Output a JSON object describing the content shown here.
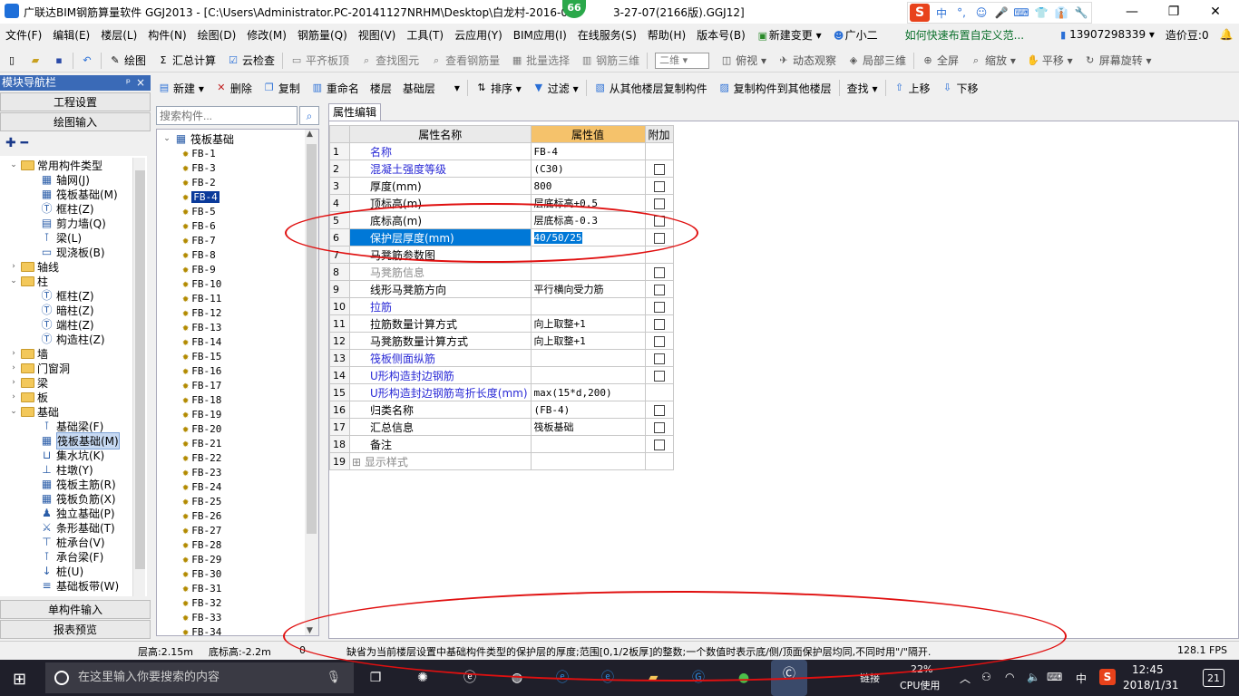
{
  "window": {
    "title": "广联达BIM钢筋算量软件 GGJ2013 - [C:\\Users\\Administrator.PC-20141127NRHM\\Desktop\\白龙村-2016-0",
    "title_tail": "3-27-07(2166版).GGJ12]",
    "badge": "66",
    "ime": {
      "logo": "S",
      "items": [
        "中",
        "°,",
        "☺",
        "🎤",
        "⌨",
        "👕",
        "👔",
        "🔧"
      ]
    },
    "controls": [
      "—",
      "❐",
      "✕"
    ]
  },
  "menubar": {
    "items": [
      "文件(F)",
      "编辑(E)",
      "楼层(L)",
      "构件(N)",
      "绘图(D)",
      "修改(M)",
      "钢筋量(Q)",
      "视图(V)",
      "工具(T)",
      "云应用(Y)",
      "BIM应用(I)",
      "在线服务(S)",
      "帮助(H)",
      "版本号(B)"
    ],
    "new_change": "新建变更 ▾",
    "assistant": "广小二",
    "hint": "如何快速布置自定义范...",
    "phone": "13907298339 ▾",
    "beans": "造价豆:0",
    "bell": "🔔"
  },
  "toolbar1": {
    "items": [
      {
        "icon": "draw-icon",
        "label": "绘图",
        "disabled": false
      },
      {
        "icon": "sum-icon",
        "label": "汇总计算",
        "disabled": false
      },
      {
        "icon": "cloud-check-icon",
        "label": "云检查",
        "disabled": false
      },
      {
        "icon": "flat-top-icon",
        "label": "平齐板顶",
        "disabled": true
      },
      {
        "icon": "find-icon",
        "label": "查找图元",
        "disabled": true
      },
      {
        "icon": "view-rebar-icon",
        "label": "查看钢筋量",
        "disabled": true
      },
      {
        "icon": "batch-select-icon",
        "label": "批量选择",
        "disabled": true
      },
      {
        "icon": "rebar-3d-icon",
        "label": "钢筋三维",
        "disabled": true
      }
    ],
    "view_select": "二维",
    "view_items": [
      {
        "icon": "top-view-icon",
        "label": "俯视 ▾"
      },
      {
        "icon": "dynamic-view-icon",
        "label": "动态观察"
      },
      {
        "icon": "local-3d-icon",
        "label": "局部三维"
      },
      {
        "icon": "fullscreen-icon",
        "label": "全屏"
      },
      {
        "icon": "zoom-icon",
        "label": "缩放 ▾"
      },
      {
        "icon": "pan-icon",
        "label": "平移 ▾"
      },
      {
        "icon": "rotate-icon",
        "label": "屏幕旋转 ▾"
      }
    ]
  },
  "nav": {
    "header": "模块导航栏",
    "pin": "ᵖ",
    "close": "×",
    "project_settings": "工程设置",
    "drawing_input": "绘图输入",
    "single_input": "单构件输入",
    "report_preview": "报表预览",
    "tools": "✚ ━",
    "tree": [
      {
        "depth": 0,
        "expander": "⌄",
        "icon": "folder",
        "label": "常用构件类型"
      },
      {
        "depth": 1,
        "icon": "grid",
        "label": "轴网(J)"
      },
      {
        "depth": 1,
        "icon": "raft",
        "label": "筏板基础(M)"
      },
      {
        "depth": 1,
        "icon": "column",
        "label": "框柱(Z)"
      },
      {
        "depth": 1,
        "icon": "wall",
        "label": "剪力墙(Q)"
      },
      {
        "depth": 1,
        "icon": "beam",
        "label": "梁(L)"
      },
      {
        "depth": 1,
        "icon": "slab",
        "label": "现浇板(B)"
      },
      {
        "depth": 0,
        "expander": "›",
        "icon": "folder",
        "label": "轴线"
      },
      {
        "depth": 0,
        "expander": "⌄",
        "icon": "folder",
        "label": "柱"
      },
      {
        "depth": 1,
        "icon": "column",
        "label": "框柱(Z)"
      },
      {
        "depth": 1,
        "icon": "column",
        "label": "暗柱(Z)"
      },
      {
        "depth": 1,
        "icon": "column",
        "label": "端柱(Z)"
      },
      {
        "depth": 1,
        "icon": "column",
        "label": "构造柱(Z)"
      },
      {
        "depth": 0,
        "expander": "›",
        "icon": "folder",
        "label": "墙"
      },
      {
        "depth": 0,
        "expander": "›",
        "icon": "folder",
        "label": "门窗洞"
      },
      {
        "depth": 0,
        "expander": "›",
        "icon": "folder",
        "label": "梁"
      },
      {
        "depth": 0,
        "expander": "›",
        "icon": "folder",
        "label": "板"
      },
      {
        "depth": 0,
        "expander": "⌄",
        "icon": "folder",
        "label": "基础"
      },
      {
        "depth": 1,
        "icon": "beam",
        "label": "基础梁(F)"
      },
      {
        "depth": 1,
        "icon": "raft",
        "label": "筏板基础(M)",
        "selected": true
      },
      {
        "depth": 1,
        "icon": "pit",
        "label": "集水坑(K)"
      },
      {
        "depth": 1,
        "icon": "pier",
        "label": "柱墩(Y)"
      },
      {
        "depth": 1,
        "icon": "raft",
        "label": "筏板主筋(R)"
      },
      {
        "depth": 1,
        "icon": "raft",
        "label": "筏板负筋(X)"
      },
      {
        "depth": 1,
        "icon": "footing",
        "label": "独立基础(P)"
      },
      {
        "depth": 1,
        "icon": "strip",
        "label": "条形基础(T)"
      },
      {
        "depth": 1,
        "icon": "cap",
        "label": "桩承台(V)"
      },
      {
        "depth": 1,
        "icon": "beam",
        "label": "承台梁(F)"
      },
      {
        "depth": 1,
        "icon": "pile",
        "label": "桩(U)"
      },
      {
        "depth": 1,
        "icon": "band",
        "label": "基础板带(W)"
      }
    ]
  },
  "mid_toolbar": {
    "items": [
      {
        "icon": "new-icon",
        "label": "新建 ▾"
      },
      {
        "icon": "delete-icon",
        "label": "删除"
      },
      {
        "icon": "copy-icon",
        "label": "复制"
      },
      {
        "icon": "rename-icon",
        "label": "重命名"
      }
    ],
    "floor_label": "楼层",
    "floor_value": "基础层",
    "sort": "排序 ▾",
    "filter": "过滤 ▾",
    "copy_from": "从其他楼层复制构件",
    "copy_to": "复制构件到其他楼层",
    "find": "查找 ▾",
    "move_up": "上移",
    "move_down": "下移"
  },
  "search": {
    "placeholder": "搜索构件..."
  },
  "component_list": {
    "root": "筏板基础",
    "items": [
      "FB-1",
      "FB-3",
      "FB-2",
      "FB-4",
      "FB-5",
      "FB-6",
      "FB-7",
      "FB-8",
      "FB-9",
      "FB-10",
      "FB-11",
      "FB-12",
      "FB-13",
      "FB-14",
      "FB-15",
      "FB-16",
      "FB-17",
      "FB-18",
      "FB-19",
      "FB-20",
      "FB-21",
      "FB-22",
      "FB-23",
      "FB-24",
      "FB-25",
      "FB-26",
      "FB-27",
      "FB-28",
      "FB-29",
      "FB-30",
      "FB-31",
      "FB-32",
      "FB-33",
      "FB-34"
    ],
    "selected": "FB-4"
  },
  "properties": {
    "tab": "属性编辑",
    "headers": {
      "name": "属性名称",
      "value": "属性值",
      "add": "附加"
    },
    "rows": [
      {
        "n": "1",
        "name": "名称",
        "value": "FB-4",
        "blue": true,
        "checkbox": false
      },
      {
        "n": "2",
        "name": "混凝土强度等级",
        "value": "(C30)",
        "blue": true,
        "checkbox": true
      },
      {
        "n": "3",
        "name": "厚度(mm)",
        "value": "800",
        "blue": false,
        "checkbox": true
      },
      {
        "n": "4",
        "name": "顶标高(m)",
        "value": "层底标高+0.5",
        "blue": false,
        "checkbox": true
      },
      {
        "n": "5",
        "name": "底标高(m)",
        "value": "层底标高-0.3",
        "blue": false,
        "checkbox": true
      },
      {
        "n": "6",
        "name": "保护层厚度(mm)",
        "value": "40/50/25",
        "blue": false,
        "checkbox": true,
        "selected": true
      },
      {
        "n": "7",
        "name": "马凳筋参数图",
        "value": "",
        "blue": false,
        "checkbox": false
      },
      {
        "n": "8",
        "name": "马凳筋信息",
        "value": "",
        "gray": true,
        "checkbox": true
      },
      {
        "n": "9",
        "name": "线形马凳筋方向",
        "value": "平行横向受力筋",
        "blue": false,
        "checkbox": true
      },
      {
        "n": "10",
        "name": "拉筋",
        "value": "",
        "blue": true,
        "checkbox": true
      },
      {
        "n": "11",
        "name": "拉筋数量计算方式",
        "value": "向上取整+1",
        "blue": false,
        "checkbox": true
      },
      {
        "n": "12",
        "name": "马凳筋数量计算方式",
        "value": "向上取整+1",
        "blue": false,
        "checkbox": true
      },
      {
        "n": "13",
        "name": "筏板侧面纵筋",
        "value": "",
        "blue": true,
        "checkbox": true
      },
      {
        "n": "14",
        "name": "U形构造封边钢筋",
        "value": "",
        "blue": true,
        "checkbox": true
      },
      {
        "n": "15",
        "name": "U形构造封边钢筋弯折长度(mm)",
        "value": "max(15*d,200)",
        "blue": true,
        "checkbox": false
      },
      {
        "n": "16",
        "name": "归类名称",
        "value": "(FB-4)",
        "blue": false,
        "checkbox": true
      },
      {
        "n": "17",
        "name": "汇总信息",
        "value": "筏板基础",
        "blue": false,
        "checkbox": true
      },
      {
        "n": "18",
        "name": "备注",
        "value": "",
        "blue": false,
        "checkbox": true
      },
      {
        "n": "19",
        "name": "显示样式",
        "value": "",
        "gray": true,
        "checkbox": false,
        "expand": true
      }
    ]
  },
  "status": {
    "floor_height": "层高:2.15m",
    "bottom_elev": "底标高:-2.2m",
    "zero": "0",
    "message": "缺省为当前楼层设置中基础构件类型的保护层的厚度;范围[0,1/2板厚]的整数;一个数值时表示底/侧/顶面保护层均同,不同时用\"/\"隔开.",
    "fps": "128.1 FPS"
  },
  "taskbar": {
    "search_placeholder": "在这里输入你要搜索的内容",
    "cpu_percent": "22%",
    "cpu_label": "CPU使用",
    "link_label": "链接",
    "lang": "中",
    "time": "12:45",
    "date": "2018/1/31",
    "notif": "21"
  }
}
